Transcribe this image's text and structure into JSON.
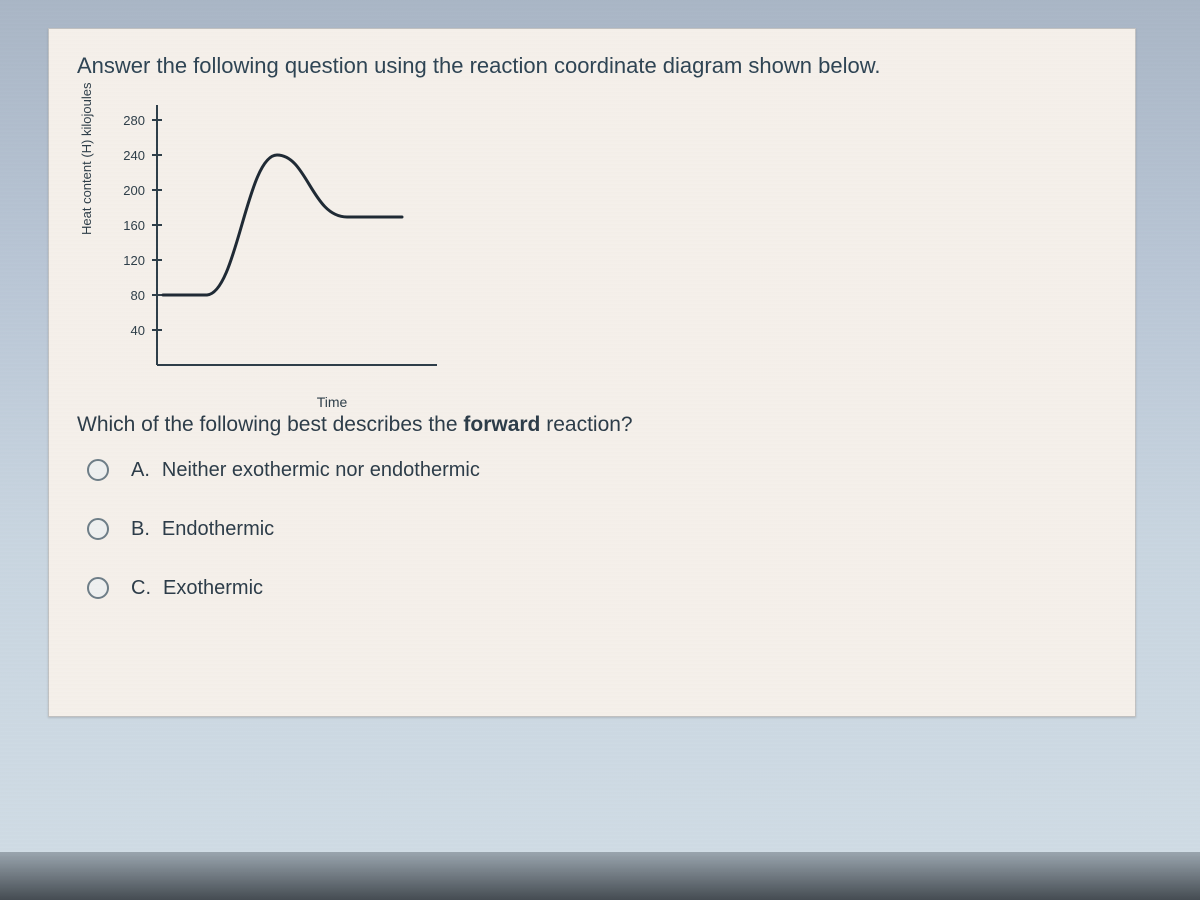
{
  "prompt": "Answer the following question using the reaction coordinate diagram shown below.",
  "chart_data": {
    "type": "line",
    "ylabel": "Heat content (H) kilojoules",
    "xlabel": "Time",
    "y_ticks": [
      40,
      80,
      120,
      160,
      200,
      240,
      280
    ],
    "ylim": [
      0,
      300
    ],
    "reactant_level": 80,
    "transition_peak": 240,
    "product_level": 170
  },
  "question_part1": "Which of the following best describes the ",
  "question_bold": "forward",
  "question_part2": " reaction?",
  "options": [
    {
      "letter": "A.",
      "text": "Neither exothermic nor endothermic"
    },
    {
      "letter": "B.",
      "text": "Endothermic"
    },
    {
      "letter": "C.",
      "text": "Exothermic"
    }
  ]
}
